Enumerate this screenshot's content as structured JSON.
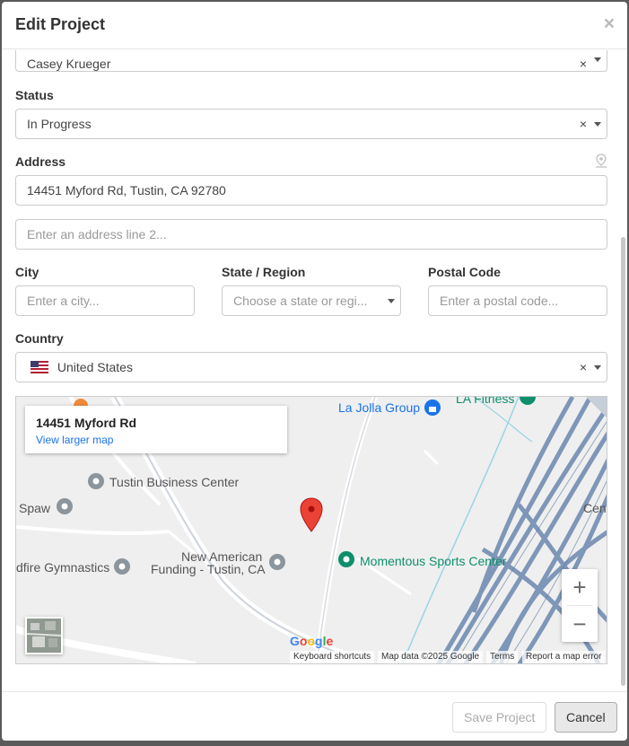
{
  "modal": {
    "title": "Edit Project",
    "close_symbol": "×"
  },
  "form": {
    "assignee_value": "Casey Krueger",
    "status_label": "Status",
    "status_value": "In Progress",
    "address_label": "Address",
    "address_line1_value": "14451 Myford Rd, Tustin, CA 92780",
    "address_line2_placeholder": "Enter an address line 2...",
    "city_label": "City",
    "city_placeholder": "Enter a city...",
    "state_label": "State / Region",
    "state_placeholder": "Choose a state or regi...",
    "postal_label": "Postal Code",
    "postal_placeholder": "Enter a postal code...",
    "country_label": "Country",
    "country_value": "United States",
    "clear_symbol": "×"
  },
  "map": {
    "card_address": "14451 Myford Rd",
    "card_link": "View larger map",
    "pois": {
      "la_jolla": "La Jolla Group",
      "la_fitness": "LA Fitness",
      "tustin_business": "Tustin Business Center",
      "spaw": "Spaw",
      "new_american_1": "New American",
      "new_american_2": "Funding - Tustin, CA",
      "momentous": "Momentous Sports Center",
      "gymnastics": "dfire Gymnastics",
      "cent": "Cent"
    },
    "zoom_in": "+",
    "zoom_out": "−",
    "google_logo": "Google",
    "attribution": {
      "shortcuts": "Keyboard shortcuts",
      "data": "Map data ©2025 Google",
      "terms": "Terms",
      "report": "Report a map error"
    }
  },
  "footer": {
    "save_label": "Save Project",
    "cancel_label": "Cancel"
  },
  "colors": {
    "pin_red": "#ea4335",
    "highway_blue": "#7e96b8",
    "link_blue": "#1a73e8",
    "poi_green": "#0d8f6c"
  }
}
